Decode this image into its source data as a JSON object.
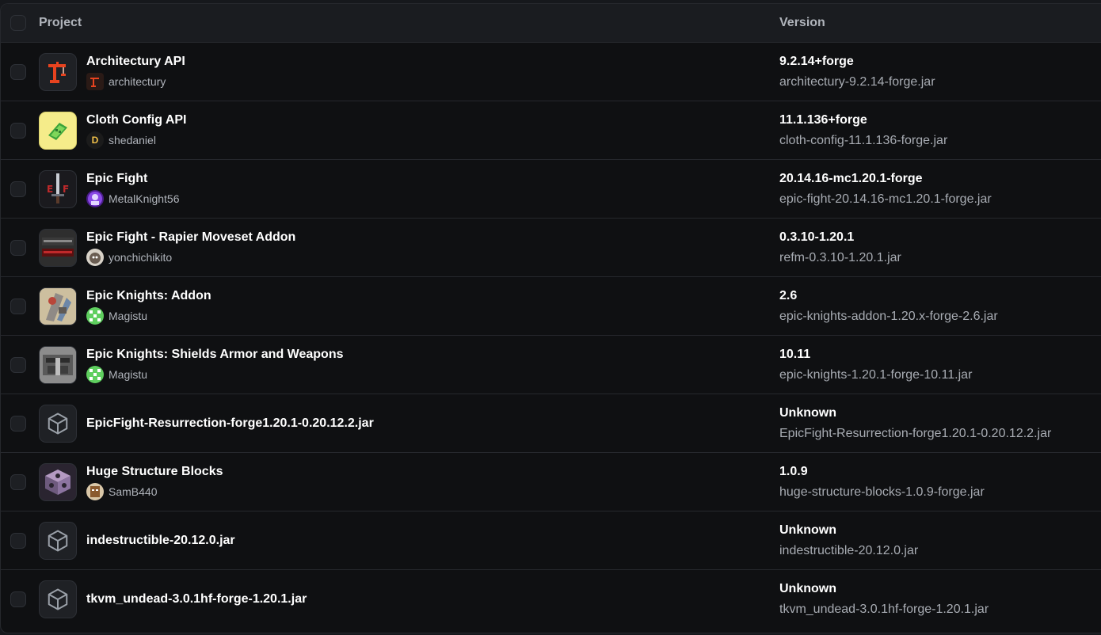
{
  "header": {
    "project_label": "Project",
    "version_label": "Version"
  },
  "mods": [
    {
      "name": "Architectury API",
      "author": "architectury",
      "icon": "architectury-crane-icon",
      "avatar": "architectury-avatar",
      "version": "9.2.14+forge",
      "file": "architectury-9.2.14-forge.jar"
    },
    {
      "name": "Cloth Config API",
      "author": "shedaniel",
      "icon": "cloth-config-icon",
      "avatar": "shedaniel-avatar",
      "version": "11.1.136+forge",
      "file": "cloth-config-11.1.136-forge.jar"
    },
    {
      "name": "Epic Fight",
      "author": "MetalKnight56",
      "icon": "epic-fight-sword-icon",
      "avatar": "metalknight56-avatar",
      "version": "20.14.16-mc1.20.1-forge",
      "file": "epic-fight-20.14.16-mc1.20.1-forge.jar"
    },
    {
      "name": "Epic Fight - Rapier Moveset Addon",
      "author": "yonchichikito",
      "icon": "rapier-addon-icon",
      "avatar": "yonchichikito-avatar",
      "version": "0.3.10-1.20.1",
      "file": "refm-0.3.10-1.20.1.jar"
    },
    {
      "name": "Epic Knights: Addon",
      "author": "Magistu",
      "icon": "epic-knights-addon-icon",
      "avatar": "magistu-avatar",
      "version": "2.6",
      "file": "epic-knights-addon-1.20.x-forge-2.6.jar"
    },
    {
      "name": "Epic Knights: Shields Armor and Weapons",
      "author": "Magistu",
      "icon": "epic-knights-helmet-icon",
      "avatar": "magistu-avatar",
      "version": "10.11",
      "file": "epic-knights-1.20.1-forge-10.11.jar"
    },
    {
      "name": "EpicFight-Resurrection-forge1.20.1-0.20.12.2.jar",
      "author": "",
      "icon": "cube-icon",
      "avatar": "",
      "version": "Unknown",
      "file": "EpicFight-Resurrection-forge1.20.1-0.20.12.2.jar"
    },
    {
      "name": "Huge Structure Blocks",
      "author": "SamB440",
      "icon": "huge-structure-blocks-icon",
      "avatar": "samb440-avatar",
      "version": "1.0.9",
      "file": "huge-structure-blocks-1.0.9-forge.jar"
    },
    {
      "name": "indestructible-20.12.0.jar",
      "author": "",
      "icon": "cube-icon",
      "avatar": "",
      "version": "Unknown",
      "file": "indestructible-20.12.0.jar"
    },
    {
      "name": "tkvm_undead-3.0.1hf-forge-1.20.1.jar",
      "author": "",
      "icon": "cube-icon",
      "avatar": "",
      "version": "Unknown",
      "file": "tkvm_undead-3.0.1hf-forge-1.20.1.jar"
    }
  ]
}
